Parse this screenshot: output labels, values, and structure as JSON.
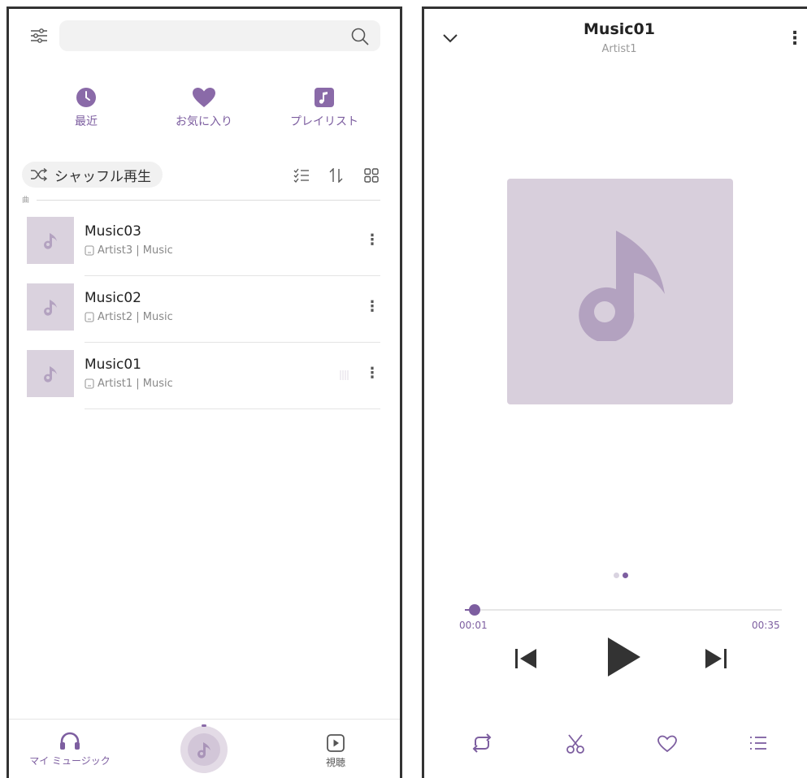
{
  "left": {
    "search": {
      "placeholder": ""
    },
    "categories": [
      {
        "label": "最近"
      },
      {
        "label": "お気に入り"
      },
      {
        "label": "プレイリスト"
      }
    ],
    "shuffle_label": "シャッフル再生",
    "section_label": "曲",
    "songs": [
      {
        "title": "Music03",
        "subtitle": "Artist3 | Music"
      },
      {
        "title": "Music02",
        "subtitle": "Artist2 | Music"
      },
      {
        "title": "Music01",
        "subtitle": "Artist1 | Music"
      }
    ],
    "bottom_nav": {
      "my_music": "マイ ミュージック",
      "listen": "視聴"
    }
  },
  "player": {
    "title": "Music01",
    "artist": "Artist1",
    "elapsed": "00:01",
    "total": "00:35",
    "progress": 0.03,
    "page_indicator": {
      "count": 2,
      "active": 1
    }
  },
  "colors": {
    "accent": "#7d5ea0",
    "art_bg": "#d8cfdc",
    "art_note": "#b3a2c0"
  }
}
